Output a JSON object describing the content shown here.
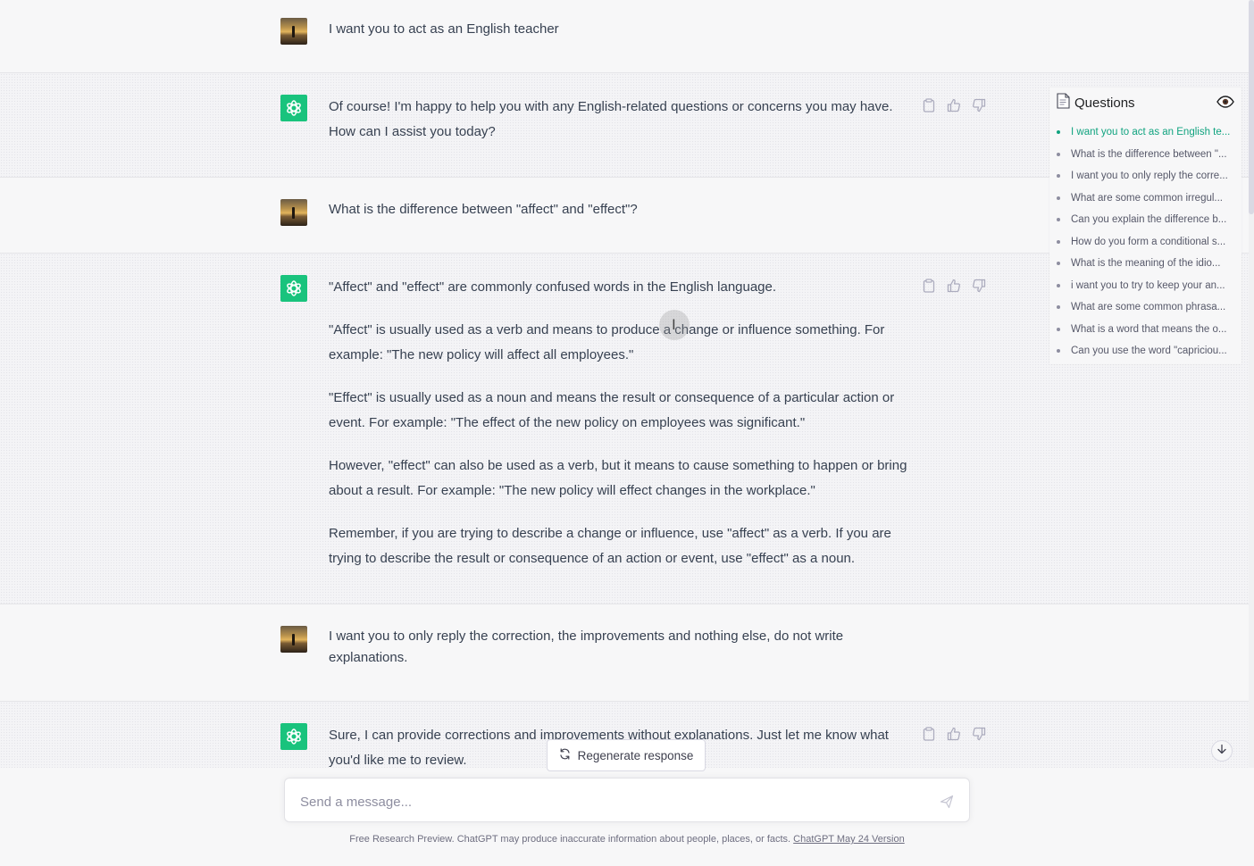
{
  "conversation": {
    "messages": [
      {
        "role": "user",
        "paragraphs": [
          "I want you to act as an English teacher"
        ]
      },
      {
        "role": "assistant",
        "paragraphs": [
          "Of course! I'm happy to help you with any English-related questions or concerns you may have. How can I assist you today?"
        ]
      },
      {
        "role": "user",
        "paragraphs": [
          "What is the difference between \"affect\" and \"effect\"?"
        ]
      },
      {
        "role": "assistant",
        "paragraphs": [
          "\"Affect\" and \"effect\" are commonly confused words in the English language.",
          "\"Affect\" is usually used as a verb and means to produce a change or influence something. For example: \"The new policy will affect all employees.\"",
          "\"Effect\" is usually used as a noun and means the result or consequence of a particular action or event. For example: \"The effect of the new policy on employees was significant.\"",
          "However, \"effect\" can also be used as a verb, but it means to cause something to happen or bring about a result. For example: \"The new policy will effect changes in the workplace.\"",
          "Remember, if you are trying to describe a change or influence, use \"affect\" as a verb. If you are trying to describe the result or consequence of an action or event, use \"effect\" as a noun."
        ]
      },
      {
        "role": "user",
        "paragraphs": [
          " I want you to only reply the correction, the improvements and nothing else, do not write explanations."
        ]
      },
      {
        "role": "assistant",
        "paragraphs": [
          "Sure, I can provide corrections and improvements without explanations. Just let me know what you'd like me to review."
        ]
      }
    ]
  },
  "questions_panel": {
    "title": "Questions",
    "items": [
      "I want you to act as an English te...",
      "What is the difference between \"...",
      "I want you to only reply the corre...",
      "What are some common irregul...",
      "Can you explain the difference b...",
      "How do you form a conditional s...",
      "What is the meaning of the idio...",
      "i want you to try to keep your an...",
      "What are some common phrasa...",
      "What is a word that means the o...",
      "Can you use the word \"capriciou..."
    ],
    "active_index": 0
  },
  "composer": {
    "regenerate_label": "Regenerate response",
    "placeholder": "Send a message..."
  },
  "footer": {
    "text": "Free Research Preview. ChatGPT may produce inaccurate information about people, places, or facts. ",
    "link": "ChatGPT May 24 Version"
  },
  "colors": {
    "accent": "#10a37f",
    "assistant_avatar": "#19c37d",
    "text": "#374151"
  },
  "icons": {
    "assistant_avatar": "openai-logo-icon",
    "message_actions": [
      "clipboard-icon",
      "thumbs-up-icon",
      "thumbs-down-icon"
    ],
    "questions_panel": [
      "document-icon",
      "eye-icon"
    ],
    "regenerate": "refresh-icon",
    "send": "send-icon",
    "scroll": "arrow-down-icon"
  }
}
